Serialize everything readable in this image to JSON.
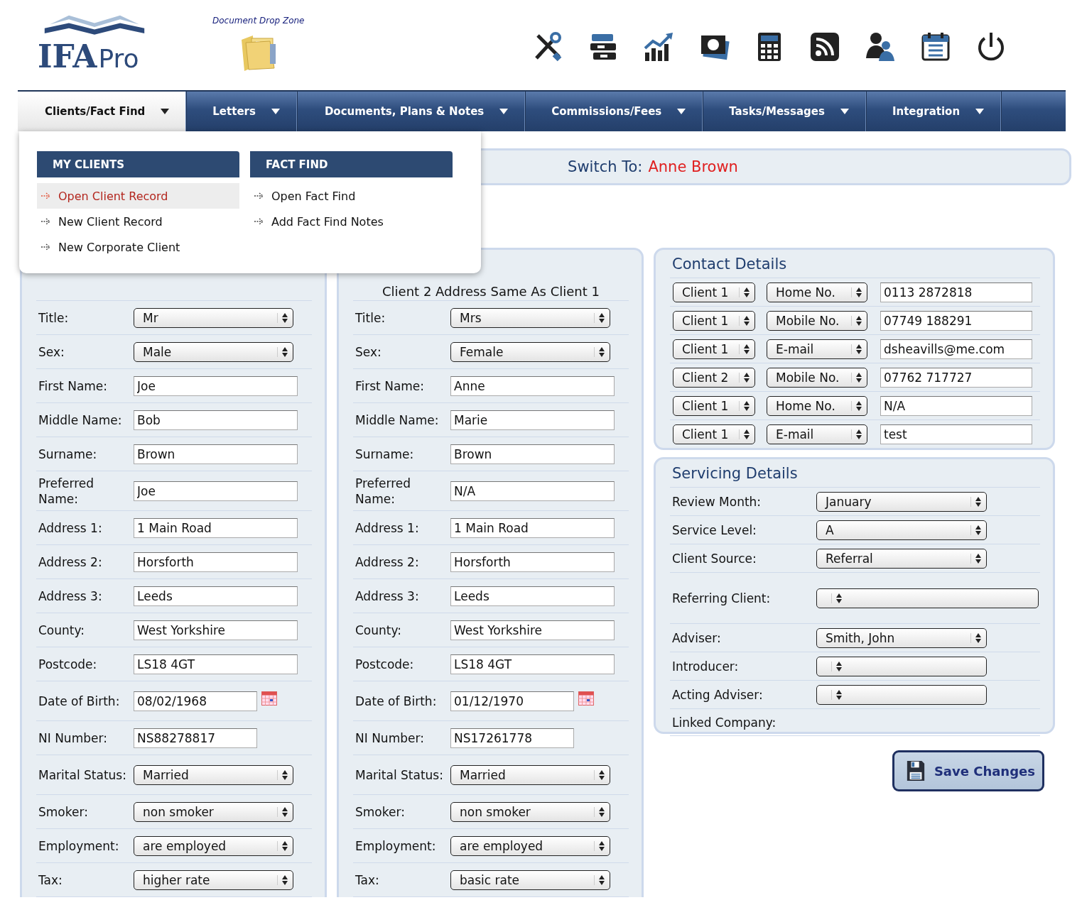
{
  "logo": {
    "bold": "IFA",
    "light": "Pro"
  },
  "drop_zone": {
    "label": "Document Drop Zone"
  },
  "toolbar": [
    {
      "kind": "tools"
    },
    {
      "kind": "files"
    },
    {
      "kind": "chart"
    },
    {
      "kind": "money"
    },
    {
      "kind": "calculator"
    },
    {
      "kind": "rss"
    },
    {
      "kind": "users"
    },
    {
      "kind": "calendar"
    },
    {
      "kind": "power"
    }
  ],
  "nav": [
    {
      "label": "Clients/Fact Find",
      "selected": true
    },
    {
      "label": "Letters",
      "selected": false
    },
    {
      "label": "Documents, Plans & Notes",
      "selected": false
    },
    {
      "label": "Commissions/Fees",
      "selected": false
    },
    {
      "label": "Tasks/Messages",
      "selected": false
    },
    {
      "label": "Integration",
      "selected": false
    }
  ],
  "menu": [
    {
      "title": "MY CLIENTS",
      "items": [
        {
          "label": "Open Client Record",
          "selected": true
        },
        {
          "label": "New Client Record",
          "selected": false
        },
        {
          "label": "New Corporate Client",
          "selected": false
        }
      ]
    },
    {
      "title": "FACT FIND",
      "items": [
        {
          "label": "Open Fact Find",
          "selected": false
        },
        {
          "label": "Add Fact Find Notes",
          "selected": false
        }
      ]
    }
  ],
  "switch_to": {
    "label": "Switch To:",
    "name": "Anne Brown"
  },
  "clients": [
    {
      "fields": [
        {
          "label": "Title:",
          "kind": "select",
          "value": "Mr"
        },
        {
          "label": "Sex:",
          "kind": "select",
          "value": "Male"
        },
        {
          "label": "First Name:",
          "kind": "text",
          "value": "Joe"
        },
        {
          "label": "Middle Name:",
          "kind": "text",
          "value": "Bob"
        },
        {
          "label": "Surname:",
          "kind": "text",
          "value": "Brown"
        },
        {
          "label": "Preferred Name:",
          "kind": "text",
          "value": "Joe"
        },
        {
          "label": "Address 1:",
          "kind": "text",
          "value": "1 Main Road"
        },
        {
          "label": "Address 2:",
          "kind": "text",
          "value": "Horsforth"
        },
        {
          "label": "Address 3:",
          "kind": "text",
          "value": "Leeds"
        },
        {
          "label": "County:",
          "kind": "text",
          "value": "West Yorkshire"
        },
        {
          "label": "Postcode:",
          "kind": "text",
          "value": "LS18 4GT"
        },
        {
          "label": "Date of Birth:",
          "kind": "date",
          "value": "08/02/1968"
        },
        {
          "label": "NI Number:",
          "kind": "short",
          "value": "NS88278817"
        },
        {
          "label": "Marital Status:",
          "kind": "select",
          "value": "Married"
        },
        {
          "label": "Smoker:",
          "kind": "select",
          "value": "non smoker"
        },
        {
          "label": "Employment:",
          "kind": "select",
          "value": "are employed"
        },
        {
          "label": "Tax:",
          "kind": "select",
          "value": "higher rate"
        }
      ]
    },
    {
      "header": "Client 2 Address Same As Client 1",
      "fields": [
        {
          "label": "Title:",
          "kind": "select",
          "value": "Mrs"
        },
        {
          "label": "Sex:",
          "kind": "select",
          "value": "Female"
        },
        {
          "label": "First Name:",
          "kind": "text",
          "value": "Anne"
        },
        {
          "label": "Middle Name:",
          "kind": "text",
          "value": "Marie"
        },
        {
          "label": "Surname:",
          "kind": "text",
          "value": "Brown"
        },
        {
          "label": "Preferred Name:",
          "kind": "text",
          "value": "N/A"
        },
        {
          "label": "Address 1:",
          "kind": "text",
          "value": "1 Main Road"
        },
        {
          "label": "Address 2:",
          "kind": "text",
          "value": "Horsforth"
        },
        {
          "label": "Address 3:",
          "kind": "text",
          "value": "Leeds"
        },
        {
          "label": "County:",
          "kind": "text",
          "value": "West Yorkshire"
        },
        {
          "label": "Postcode:",
          "kind": "text",
          "value": "LS18 4GT"
        },
        {
          "label": "Date of Birth:",
          "kind": "date",
          "value": "01/12/1970"
        },
        {
          "label": "NI Number:",
          "kind": "short",
          "value": "NS17261778"
        },
        {
          "label": "Marital Status:",
          "kind": "select",
          "value": "Married"
        },
        {
          "label": "Smoker:",
          "kind": "select",
          "value": "non smoker"
        },
        {
          "label": "Employment:",
          "kind": "select",
          "value": "are employed"
        },
        {
          "label": "Tax:",
          "kind": "select",
          "value": "basic rate"
        }
      ]
    }
  ],
  "contact": {
    "title": "Contact Details",
    "rows": [
      {
        "client": "Client 1",
        "type": "Home No.",
        "value": "0113 2872818"
      },
      {
        "client": "Client 1",
        "type": "Mobile No.",
        "value": "07749 188291"
      },
      {
        "client": "Client 1",
        "type": "E-mail",
        "value": "dsheavills@me.com"
      },
      {
        "client": "Client 2",
        "type": "Mobile No.",
        "value": "07762 717727"
      },
      {
        "client": "Client 1",
        "type": "Home No.",
        "value": "N/A"
      },
      {
        "client": "Client 1",
        "type": "E-mail",
        "value": "test"
      }
    ]
  },
  "servicing": {
    "title": "Servicing Details",
    "rows": [
      {
        "label": "Review Month:",
        "kind": "select",
        "value": "January"
      },
      {
        "label": "Service Level:",
        "kind": "select",
        "value": "A"
      },
      {
        "label": "Client Source:",
        "kind": "select",
        "value": "Referral"
      },
      {
        "label": "Referring Client:",
        "kind": "wide_select"
      },
      {
        "label": "Adviser:",
        "kind": "select",
        "value": "Smith, John"
      },
      {
        "label": "Introducer:",
        "kind": "select"
      },
      {
        "label": "Acting Adviser:",
        "kind": "select"
      },
      {
        "label": "Linked Company:",
        "kind": "none"
      }
    ]
  },
  "save": {
    "label": "Save Changes"
  }
}
